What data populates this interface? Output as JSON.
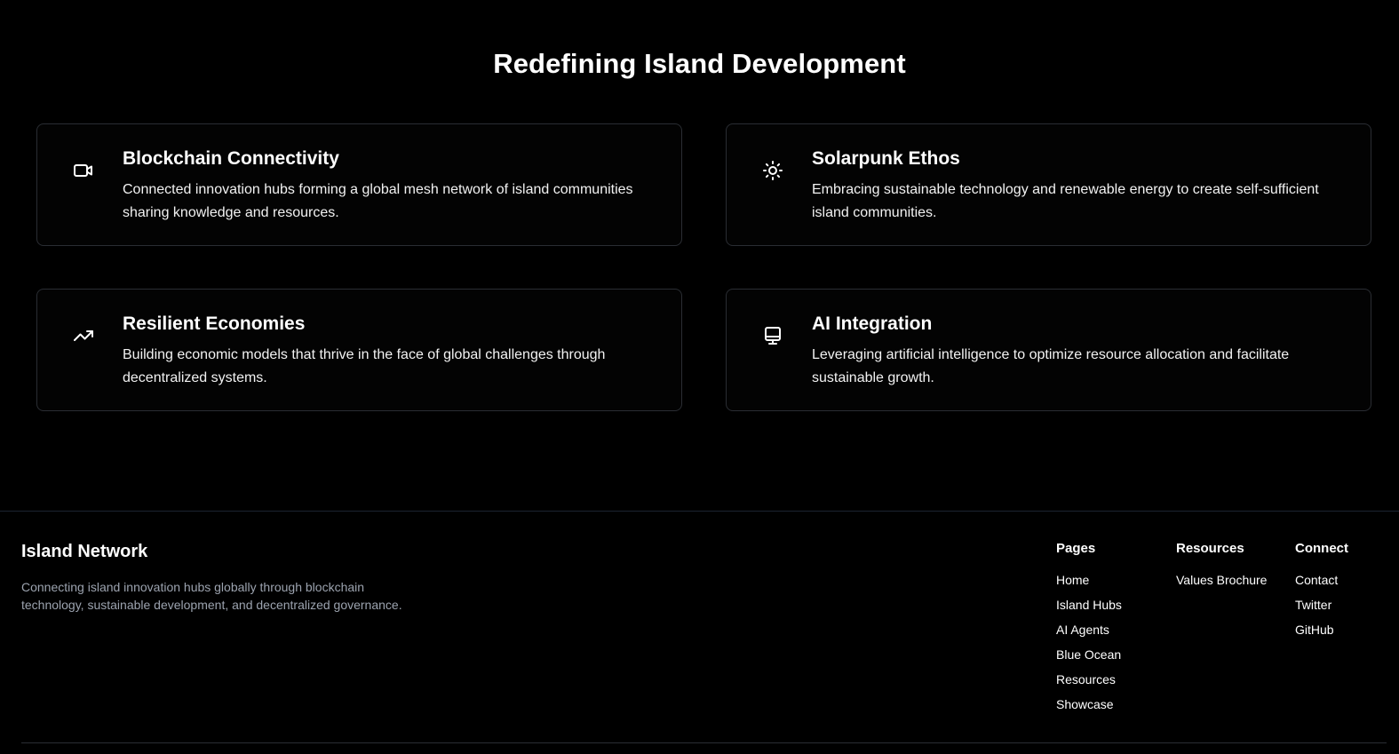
{
  "section": {
    "title": "Redefining Island Development"
  },
  "features": [
    {
      "icon": "video-icon",
      "title": "Blockchain Connectivity",
      "description": "Connected innovation hubs forming a global mesh network of island communities sharing knowledge and resources."
    },
    {
      "icon": "sun-icon",
      "title": "Solarpunk Ethos",
      "description": "Embracing sustainable technology and renewable energy to create self-sufficient island communities."
    },
    {
      "icon": "trending-up-icon",
      "title": "Resilient Economies",
      "description": "Building economic models that thrive in the face of global challenges through decentralized systems."
    },
    {
      "icon": "monitor-icon",
      "title": "AI Integration",
      "description": "Leveraging artificial intelligence to optimize resource allocation and facilitate sustainable growth."
    }
  ],
  "footer": {
    "brand_name": "Island Network",
    "brand_description": "Connecting island innovation hubs globally through blockchain technology, sustainable development, and decentralized governance.",
    "columns": [
      {
        "title": "Pages",
        "links": [
          "Home",
          "Island Hubs",
          "AI Agents",
          "Blue Ocean",
          "Resources",
          "Showcase"
        ]
      },
      {
        "title": "Resources",
        "links": [
          "Values Brochure"
        ]
      },
      {
        "title": "Connect",
        "links": [
          "Contact",
          "Twitter",
          "GitHub"
        ]
      }
    ]
  },
  "colors": {
    "background": "#000000",
    "card_border": "#2a2d33",
    "muted_text": "#9ca3af",
    "text": "#ffffff"
  }
}
